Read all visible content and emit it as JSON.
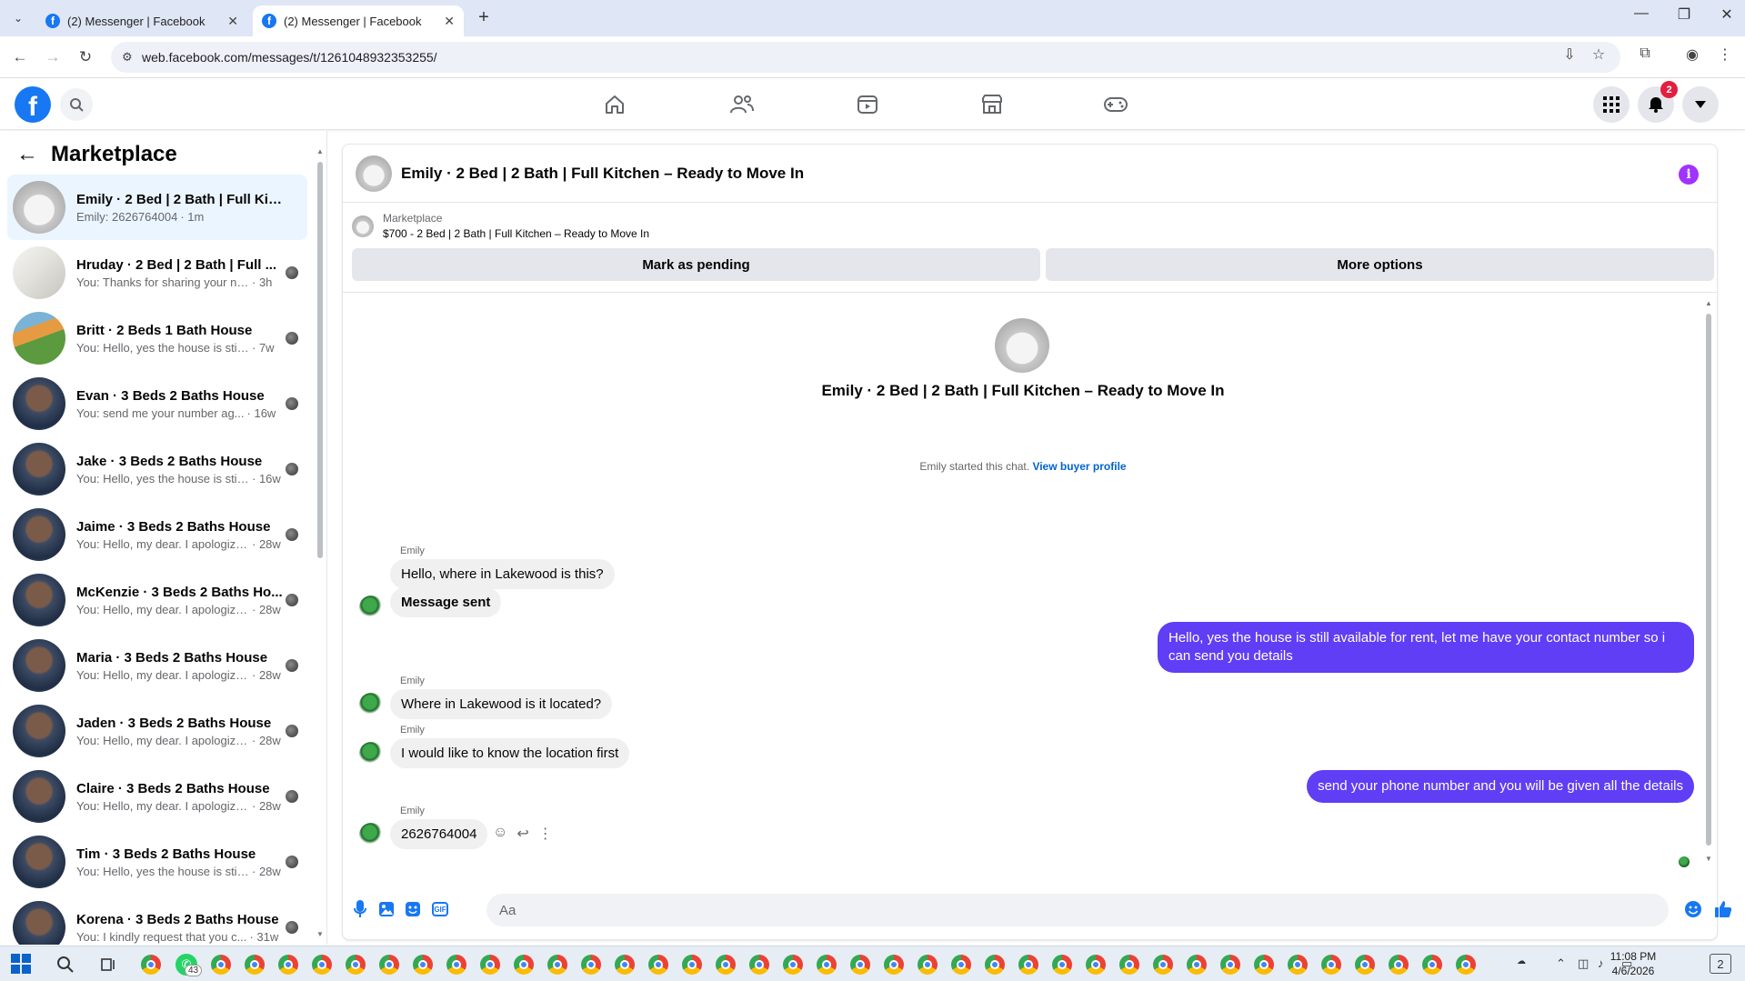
{
  "browser": {
    "tabs": [
      {
        "title": "(2) Messenger | Facebook",
        "active": false
      },
      {
        "title": "(2) Messenger | Facebook",
        "active": true
      }
    ],
    "new_tab": "+",
    "url": "web.facebook.com/messages/t/1261048932353255/",
    "window_controls": {
      "minimize": "—",
      "maximize": "❐",
      "close": "✕"
    }
  },
  "fb_header": {
    "logo": "f",
    "notification_count": "2",
    "nav_icons": [
      "home-icon",
      "friends-icon",
      "video-icon",
      "marketplace-icon",
      "gaming-icon"
    ],
    "brand_color": "#1877f2"
  },
  "sidebar": {
    "title": "Marketplace",
    "conversations": [
      {
        "name": "Emily · 2 Bed | 2 Bath | Full Kitch...",
        "snippet": "Emily: 2626764004",
        "age": "· 1m",
        "thumb": "white",
        "selected": true
      },
      {
        "name": "Hruday · 2 Bed | 2 Bath | Full ...",
        "snippet": "You: Thanks for sharing your nu...",
        "age": "· 3h",
        "thumb": "bath"
      },
      {
        "name": "Britt · 2 Beds 1 Bath House",
        "snippet": "You: Hello, yes the house is still ...",
        "age": "· 7w",
        "thumb": "colorful"
      },
      {
        "name": "Evan · 3 Beds 2 Baths House",
        "snippet": "You: send me your number ag...",
        "age": "· 16w",
        "thumb": "house"
      },
      {
        "name": "Jake · 3 Beds 2 Baths House",
        "snippet": "You: Hello, yes the house is still...",
        "age": "· 16w",
        "thumb": "house"
      },
      {
        "name": "Jaime · 3 Beds 2 Baths House",
        "snippet": "You: Hello, my dear. I apologize fo...",
        "age": "· 28w",
        "thumb": "house"
      },
      {
        "name": "McKenzie · 3 Beds 2 Baths Ho...",
        "snippet": "You: Hello, my dear. I apologize...",
        "age": "· 28w",
        "thumb": "house"
      },
      {
        "name": "Maria · 3 Beds 2 Baths House",
        "snippet": "You: Hello, my dear. I apologize fo...",
        "age": "· 28w",
        "thumb": "house"
      },
      {
        "name": "Jaden · 3 Beds 2 Baths House",
        "snippet": "You: Hello, my dear. I apologize fo...",
        "age": "· 28w",
        "thumb": "house"
      },
      {
        "name": "Claire · 3 Beds 2 Baths House",
        "snippet": "You: Hello, my dear. I apologize fo...",
        "age": "· 28w",
        "thumb": "house"
      },
      {
        "name": "Tim · 3 Beds 2 Baths House",
        "snippet": "You: Hello, yes the house is still...",
        "age": "· 28w",
        "thumb": "house"
      },
      {
        "name": "Korena · 3 Beds 2 Baths House",
        "snippet": "You: I kindly request that you c...",
        "age": "· 31w",
        "thumb": "house"
      }
    ]
  },
  "chat": {
    "title": "Emily · 2 Bed | 2 Bath | Full Kitchen – Ready to Move In",
    "listing_category": "Marketplace",
    "listing_desc": "$700 - 2 Bed | 2 Bath | Full Kitchen – Ready to Move In",
    "mark_pending": "Mark as pending",
    "more_options": "More options",
    "intro_title": "Emily · 2 Bed | 2 Bath | Full Kitchen – Ready to Move In",
    "started_text": "Emily started this chat. ",
    "buyer_profile_link": "View buyer profile",
    "messages": [
      {
        "from": "Emily",
        "sender_label": "Emily",
        "text": "Hello, where in Lakewood is this?"
      },
      {
        "from": "Emily",
        "text": "Message sent"
      },
      {
        "from": "me",
        "text": "Hello, yes the house is still available for rent, let me have your contact number so i can send you  details"
      },
      {
        "from": "Emily",
        "sender_label": "Emily",
        "text": "Where in Lakewood is it located?"
      },
      {
        "from": "Emily",
        "sender_label": "Emily",
        "text": "I would like to know the location first"
      },
      {
        "from": "me",
        "text": "send your phone number and you will be given all the details"
      },
      {
        "from": "Emily",
        "sender_label": "Emily",
        "text": "2626764004"
      }
    ],
    "composer_placeholder": "Aa",
    "outgoing_color": "#5f3ef5",
    "accent_color": "#1877f2"
  },
  "taskbar": {
    "whatsapp_badge": "43",
    "time": "11:08 PM",
    "date": "4/6/2026",
    "notification_count": "2"
  }
}
